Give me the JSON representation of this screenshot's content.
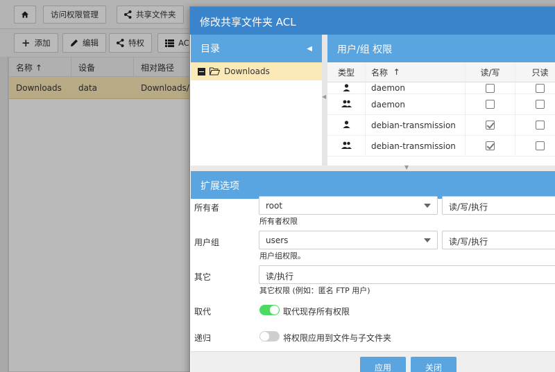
{
  "background": {
    "nav": {
      "access_manage": "访问权限管理",
      "share_folder": "共享文件夹"
    },
    "toolbar": {
      "add": "添加",
      "edit": "编辑",
      "privilege": "特权",
      "acl": "ACL"
    },
    "grid": {
      "headers": [
        "名称",
        "设备",
        "相对路径"
      ],
      "rows": [
        {
          "name": "Downloads",
          "device": "data",
          "path": "Downloads/"
        }
      ]
    }
  },
  "modal": {
    "title": "修改共享文件夹 ACL",
    "directory": {
      "header": "目录",
      "item": "Downloads"
    },
    "permissions": {
      "header": "用户/组 权限",
      "columns": {
        "type": "类型",
        "name": "名称",
        "rw": "读/写",
        "ro": "只读"
      },
      "rows": [
        {
          "type": "user",
          "name": "daemon",
          "rw": false,
          "ro": false
        },
        {
          "type": "group",
          "name": "daemon",
          "rw": false,
          "ro": false
        },
        {
          "type": "user",
          "name": "debian-transmission",
          "rw": true,
          "ro": false
        },
        {
          "type": "group",
          "name": "debian-transmission",
          "rw": true,
          "ro": false
        }
      ]
    },
    "extended": {
      "header": "扩展选项",
      "owner": {
        "label": "所有者",
        "value": "root",
        "perm": "读/写/执行",
        "hint": "所有者权限"
      },
      "group": {
        "label": "用户组",
        "value": "users",
        "perm": "读/写/执行",
        "hint": "用户组权限。"
      },
      "other": {
        "label": "其它",
        "value": "读/执行",
        "hint": "其它权限 (例如：匿名 FTP 用户)"
      },
      "replace": {
        "label": "取代",
        "text": "取代现存所有权限",
        "enabled": true
      },
      "recursive": {
        "label": "递归",
        "text": "将权限应用到文件与子文件夹",
        "enabled": false
      }
    },
    "buttons": {
      "apply": "应用",
      "close": "关闭"
    },
    "colors": {
      "title_bar": "#3a84cc",
      "header_bar": "#5aa5e0",
      "selected_row": "#fbe9b7",
      "toggle_on": "#4cd964",
      "toggle_off": "#cfcfcf"
    }
  }
}
